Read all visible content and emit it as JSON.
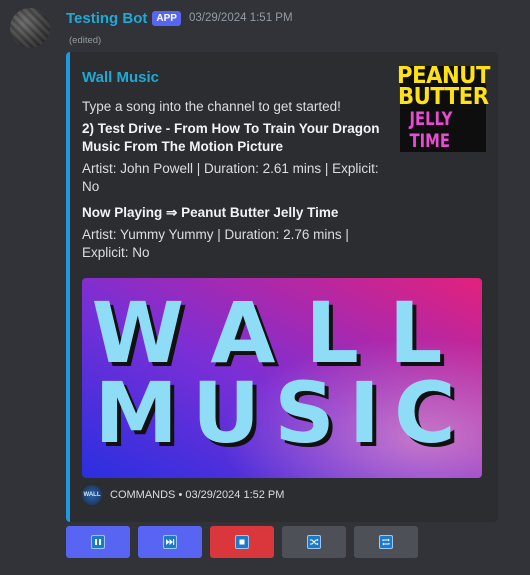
{
  "message": {
    "username": "Testing Bot",
    "badge": "APP",
    "timestamp": "03/29/2024 1:51 PM",
    "edited": "(edited)"
  },
  "embed": {
    "title": "Wall Music",
    "accent_color": "#1e9ae0",
    "intro": "Type a song into the channel to get started!",
    "queued": {
      "title": "2) Test Drive - From How To Train Your Dragon Music From The Motion Picture",
      "details": "Artist: John Powell | Duration: 2.61 mins | Explicit: No"
    },
    "now_playing": {
      "title": "Now Playing  ⇒  Peanut Butter Jelly Time",
      "details": "Artist: Yummy Yummy | Duration: 2.76 mins | Explicit: No"
    },
    "thumbnail": {
      "line1": "PEANUT",
      "line2": "BUTTER",
      "line3": "JELLY TIME"
    },
    "banner": {
      "line1": "WALL",
      "line2": "MUSIC"
    },
    "footer": {
      "icon_text": "WALL",
      "text": "COMMANDS • 03/29/2024 1:52 PM"
    }
  },
  "buttons": [
    {
      "name": "pause",
      "icon": "pause-icon",
      "style": "primary"
    },
    {
      "name": "skip",
      "icon": "skip-icon",
      "style": "primary"
    },
    {
      "name": "stop",
      "icon": "stop-icon",
      "style": "danger"
    },
    {
      "name": "shuffle",
      "icon": "shuffle-icon",
      "style": "secondary"
    },
    {
      "name": "loop",
      "icon": "loop-icon",
      "style": "secondary"
    }
  ]
}
